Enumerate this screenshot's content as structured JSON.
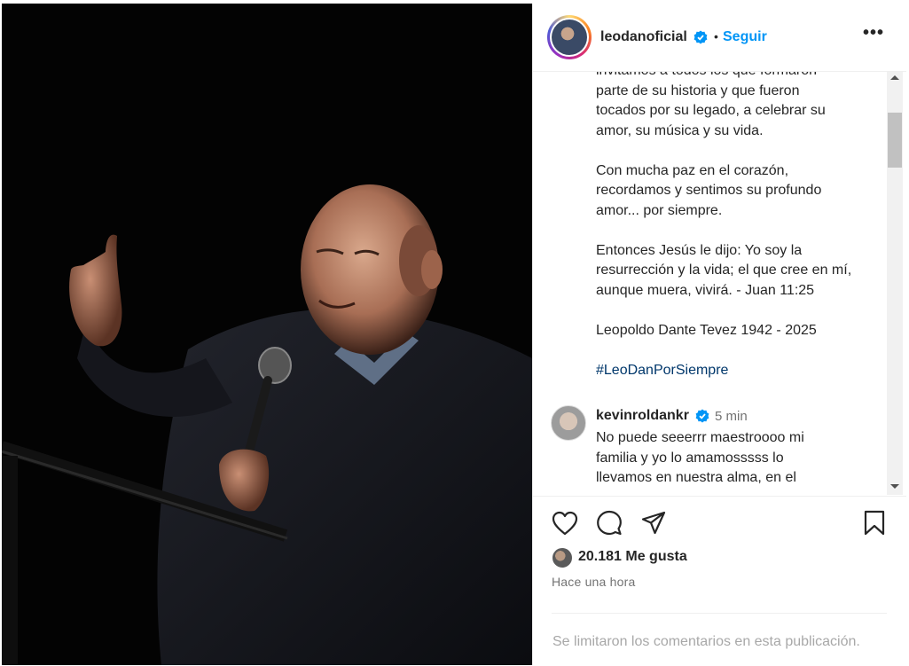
{
  "post": {
    "username": "leodanoficial",
    "follow_label": "Seguir",
    "separator": "•",
    "more_label": "•••"
  },
  "caption": {
    "lines_a": [
      "invitamos a todos los que formaron",
      "parte de su historia y que fueron",
      "tocados por su legado, a celebrar su",
      "amor, su música y su vida."
    ],
    "lines_b": [
      "Con mucha paz en el corazón,",
      "recordamos y sentimos su profundo",
      "amor... por siempre."
    ],
    "lines_c": [
      "Entonces Jesús le dijo: Yo soy la",
      "resurrección y la vida; el que cree en mí,",
      "aunque muera, vivirá. - Juan 11:25"
    ],
    "lines_d": [
      "Leopoldo Dante Tevez 1942 - 2025"
    ],
    "hashtag": "#LeoDanPorSiempre"
  },
  "comment": {
    "username": "kevinroldankr",
    "time": "5 min",
    "lines": [
      "No puede seeerrr maestroooo mi",
      "familia y yo lo amamosssss lo",
      "llevamos en nuestra alma, en el"
    ]
  },
  "footer": {
    "likes": "20.181 Me gusta",
    "time_ago": "Hace una hora",
    "comments_limited": "Se limitaron los comentarios en esta publicación."
  },
  "colors": {
    "accent": "#0095f6",
    "hashtag": "#00376b",
    "verified": "#0095f6",
    "muted": "#737373"
  }
}
